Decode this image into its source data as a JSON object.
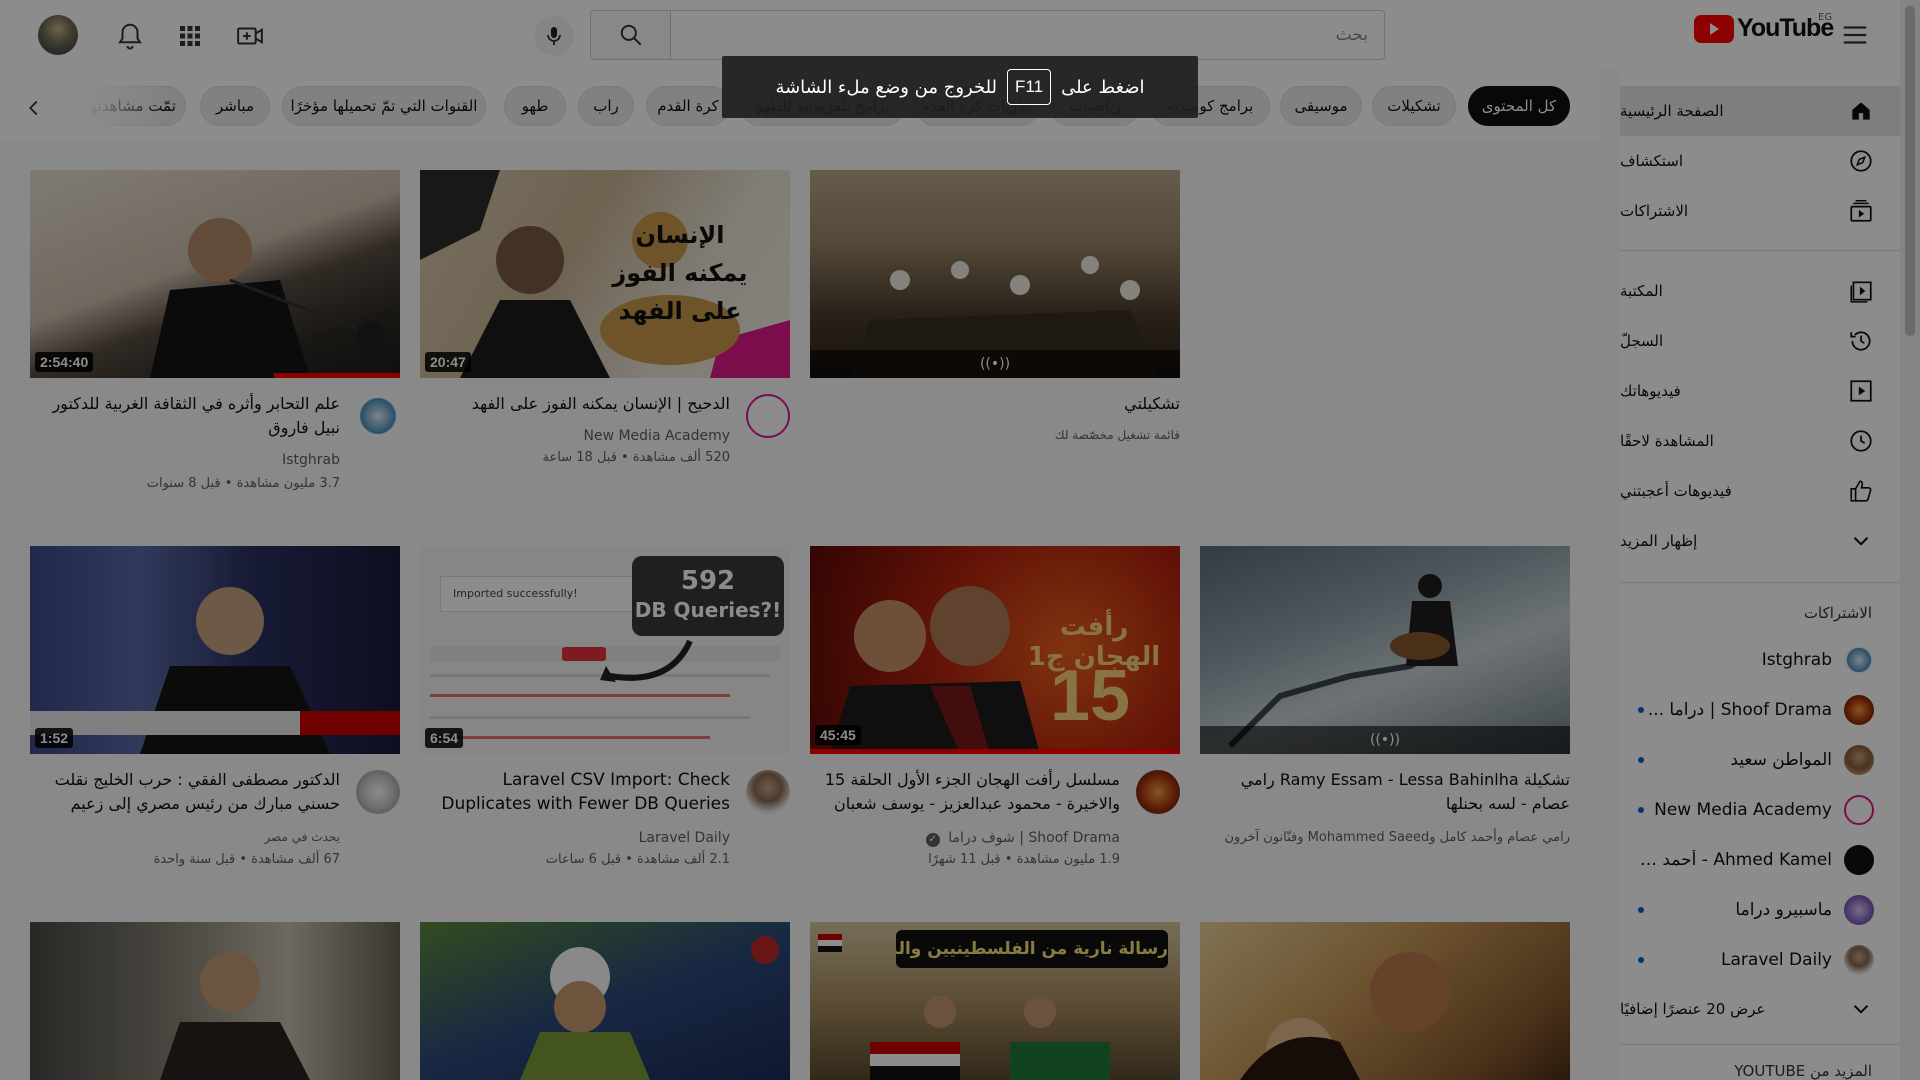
{
  "colors": {
    "brand_red": "#ff0000",
    "active_chip": "#0f0f0f",
    "link_dot": "#065fd4"
  },
  "header": {
    "search_placeholder": "بحث",
    "logo_text": "YouTube",
    "region": "EG",
    "icons": [
      "menu-icon",
      "youtube-logo-icon",
      "search-icon",
      "mic-icon",
      "create-icon",
      "apps-icon",
      "bell-icon",
      "avatar"
    ]
  },
  "fullscreen_toast": {
    "before": "اضغط على",
    "key": "F11",
    "after": "للخروج من وضع ملء الشاشة"
  },
  "chips": [
    {
      "label": "كل المحتوى",
      "active": true
    },
    {
      "label": "تشكيلات"
    },
    {
      "label": "موسيقى"
    },
    {
      "label": "برامج كوميدية"
    },
    {
      "label": "رياضيات"
    },
    {
      "label": "مباريات كرة القدم"
    },
    {
      "label": "برامج تلفزيونية للطهو"
    },
    {
      "label": "كرة القدم"
    },
    {
      "label": "راب"
    },
    {
      "label": "طهو"
    },
    {
      "label": "القنوات التي تمّ تحميلها مؤخرًا"
    },
    {
      "label": "مباشر"
    },
    {
      "label": "تمّت مشاهدتها"
    }
  ],
  "sidebar": {
    "main": [
      {
        "label": "الصفحة الرئيسية",
        "icon": "home-icon",
        "active": true
      },
      {
        "label": "استكشاف",
        "icon": "explore-icon"
      },
      {
        "label": "الاشتراكات",
        "icon": "subscriptions-icon"
      }
    ],
    "library": [
      {
        "label": "المكتبة",
        "icon": "library-icon"
      },
      {
        "label": "السجلّ",
        "icon": "history-icon"
      },
      {
        "label": "فيديوهاتك",
        "icon": "your-videos-icon"
      },
      {
        "label": "المشاهدة لاحقًا",
        "icon": "watch-later-icon"
      },
      {
        "label": "فيديوهات أعجبتني",
        "icon": "liked-icon"
      },
      {
        "label": "إظهار المزيد",
        "icon": "chevron-down-icon"
      }
    ],
    "subs_title": "الاشتراكات",
    "subscriptions": [
      {
        "name": "Istghrab",
        "dot": false
      },
      {
        "name": "Shoof Drama | دراما ...",
        "dot": true
      },
      {
        "name": "المواطن سعيد",
        "dot": true
      },
      {
        "name": "New Media Academy",
        "dot": true
      },
      {
        "name": "Ahmed Kamel - أحمد كامل",
        "dot": false
      },
      {
        "name": "ماسبيرو دراما",
        "dot": true
      },
      {
        "name": "Laravel Daily",
        "dot": true
      }
    ],
    "show_more_subs": "عرض 20 عنصرًا إضافيًا",
    "more_from": "المزيد من YOUTUBE"
  },
  "videos": [
    {
      "title": "علم التحابر وأثره في الثقافة الغربية للدكتور نبيل فاروق",
      "channel": "Istghrab",
      "meta": "3.7 مليون مشاهدة • قبل 8 سنوات",
      "duration": "2:54:40",
      "progress": 0.34
    },
    {
      "title": "الدحيح | الإنسان يمكنه الفوز على الفهد",
      "channel": "New Media Academy",
      "meta": "520 ألف مشاهدة • قبل 18 ساعة",
      "duration": "20:47",
      "thumb_text": "الإنسان يمكنه الفوز على الفهد"
    },
    {
      "title": "تشكيلتي",
      "channel": "قائمة تشغيل مخصّصة لك",
      "meta": "",
      "live_symbol": "((•))"
    },
    {
      "title": "الدكتور مصطفى الفقي : حرب الخليج نقلت حسني مبارك من رئيس مصري إلى زعيم عربي",
      "channel": "يحدث في مصر",
      "meta": "67 ألف مشاهدة • قبل سنة واحدة",
      "duration": "1:52"
    },
    {
      "title": "Laravel CSV Import: Check Duplicates with Fewer DB Queries",
      "channel": "Laravel Daily",
      "meta": "2.1 ألف مشاهدة • قبل 6 ساعات",
      "duration": "6:54",
      "thumb_big": "592",
      "thumb_small": "DB Queries?!",
      "thumb_note": "Imported successfully!"
    },
    {
      "title": "مسلسل رأفت الهجان الجزء الأول الحلقة 15 والاخيرة - محمود عبدالعزيز - يوسف شعبان",
      "channel": "Shoof Drama | شوف دراما",
      "meta": "1.9 مليون مشاهدة • قبل 11 شهرًا",
      "duration": "45:45",
      "thumb_text": "رأفت الهجان ج1",
      "thumb_num": "15",
      "progress": 1.0
    },
    {
      "title": "تشكيلة Ramy Essam - Lessa Bahinlha رامي عصام - لسه بحنلها",
      "channel": "رامي عصام وأحمد كامل وMohammed Saeed وفنّانون آخرون",
      "meta": "",
      "live_symbol": "((•))"
    },
    {
      "title": "",
      "channel": "",
      "meta": ""
    },
    {
      "title": "",
      "channel": "",
      "meta": ""
    },
    {
      "title": "",
      "channel": "",
      "meta": "",
      "thumb_text": "رسالة نارية من الفلسطينيين والمصريين"
    },
    {
      "title": "",
      "channel": "",
      "meta": ""
    }
  ]
}
